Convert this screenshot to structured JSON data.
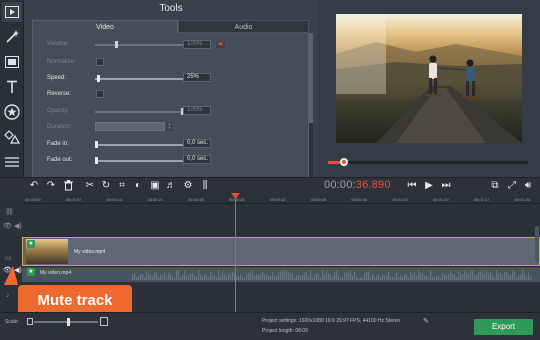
{
  "left_toolbar": {
    "items": [
      {
        "name": "media-icon",
        "glyph": "▶"
      },
      {
        "name": "magic-wand-icon",
        "glyph": "✎"
      },
      {
        "name": "clips-icon",
        "glyph": "▦"
      },
      {
        "name": "titles-icon",
        "glyph": "T"
      },
      {
        "name": "stickers-icon",
        "glyph": "★"
      },
      {
        "name": "transitions-icon",
        "glyph": "◇"
      },
      {
        "name": "more-icon",
        "glyph": "☰"
      }
    ]
  },
  "tools": {
    "title": "Tools",
    "tabs": {
      "video": "Video",
      "audio": "Audio"
    },
    "rows": {
      "volume": {
        "label": "Volume:",
        "value": "100%"
      },
      "normalize": {
        "label": "Normalize:"
      },
      "speed": {
        "label": "Speed:",
        "value": "25%"
      },
      "reverse": {
        "label": "Reverse:"
      },
      "opacity": {
        "label": "Opacity:",
        "value": "100%"
      },
      "duration": {
        "label": "Duration:"
      },
      "fade_in": {
        "label": "Fade in:",
        "value": "0,0 sec."
      },
      "fade_out": {
        "label": "Fade out:",
        "value": "0,0 sec."
      }
    }
  },
  "playback": {
    "timecode_dim": "00:00:",
    "timecode_red": "36.890",
    "progress_fraction": 0.08
  },
  "timeline": {
    "ticks": [
      "00:00:00",
      "00:00:07",
      "00:00:14",
      "00:00:21",
      "00:00:28",
      "00:00:35",
      "00:00:42",
      "00:00:49",
      "00:00:56",
      "00:01:03",
      "00:01:10",
      "00:01:17",
      "00:01:24"
    ],
    "video_clip_label": "My video.mp4",
    "audio_clip_label": "My video.mp4"
  },
  "tooltip": {
    "text": "Mute track"
  },
  "bottom": {
    "scale_label": "Scale:",
    "project_settings": "Project settings:  1920x1080 16:9 29.97 FPS, 44100 Hz Stereo",
    "project_length": "Project length:   08:09",
    "export_label": "Export"
  },
  "colors": {
    "accent_red": "#ef4b3e",
    "export_green": "#2e9a58",
    "tooltip_orange": "#ef6a2e",
    "clip_border": "#c8a64a"
  }
}
